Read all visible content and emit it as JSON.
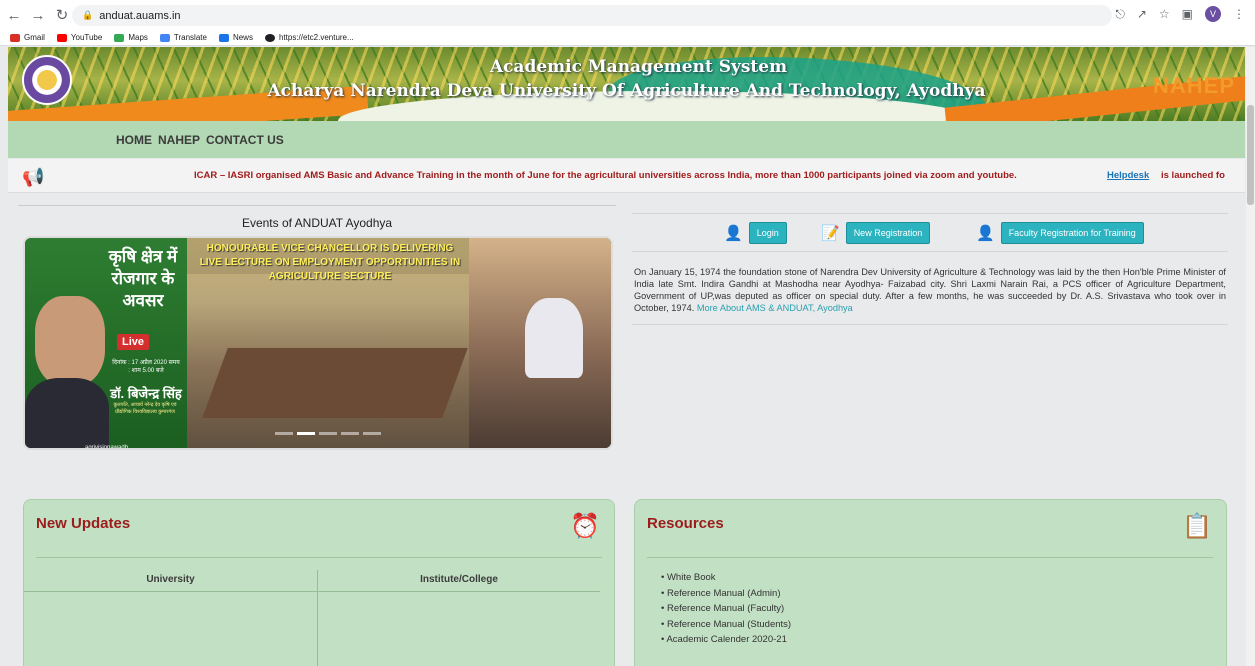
{
  "browser": {
    "url": "anduat.auams.in",
    "profile_initial": "V",
    "bookmarks": [
      {
        "label": "Gmail",
        "color": "#d93025"
      },
      {
        "label": "YouTube",
        "color": "#ff0000"
      },
      {
        "label": "Maps",
        "color": "#34a853"
      },
      {
        "label": "Translate",
        "color": "#4285f4"
      },
      {
        "label": "News",
        "color": "#1a73e8"
      },
      {
        "label": "https://etc2.venture...",
        "color": "#202124"
      }
    ]
  },
  "banner": {
    "title": "Academic Management System",
    "subtitle": "Acharya Narendra Deva University Of Agriculture And Technology, Ayodhya",
    "partner_logo": "NAHEP"
  },
  "nav": {
    "items": [
      "HOME",
      "NAHEP",
      "CONTACT US"
    ]
  },
  "ticker": {
    "text": "ICAR – IASRI organised AMS Basic and Advance Training in the month of June for the agricultural universities across India, more than 1000 participants joined via zoom and youtube.",
    "link": "Helpdesk",
    "after": "is launched fo"
  },
  "events": {
    "title": "Events of ANDUAT Ayodhya",
    "poster_heading": "कृषि क्षेत्र में रोजगार के अवसर",
    "poster_live": "Live",
    "poster_date": "दिनांक : 17 अप्रैल 2020  समय : शाम 5.00 बजे",
    "poster_name": "डॉ. बिजेन्द्र सिंह",
    "poster_sub": "कुलपति, आचार्य नरेन्द्र देव कृषि एवं प्रौद्योगिक विश्वविद्यालय कुमारगंज",
    "poster_social": "agrivisionawadh",
    "caption": "HONOURABLE VICE CHANCELLOR IS DELIVERING LIVE LECTURE ON EMPLOYMENT OPPORTUNITIES IN AGRICULTURE SECTURE",
    "slides_active": 2
  },
  "actions": {
    "login": "Login",
    "new_registration": "New Registration",
    "faculty_registration": "Faculty Registration for Training"
  },
  "about": {
    "text": "On January 15, 1974 the foundation stone of Narendra Dev University of Agriculture & Technology was laid by the then Hon'ble Prime Minister of India late Smt. Indira Gandhi at Mashodha near Ayodhya- Faizabad city. Shri Laxmi Narain Rai, a PCS officer of Agriculture Department, Government of UP,was deputed as officer on special duty. After a few months, he was succeeded by Dr. A.S. Srivastava who took over in October, 1974.",
    "link": "More About AMS & ANDUAT, Ayodhya"
  },
  "updates": {
    "title": "New Updates",
    "col1": "University",
    "col2": "Institute/College"
  },
  "resources": {
    "title": "Resources",
    "items": [
      "White Book",
      "Reference Manual (Admin)",
      "Reference Manual (Faculty)",
      "Reference Manual (Students)",
      "Academic Calender 2020-21"
    ]
  }
}
